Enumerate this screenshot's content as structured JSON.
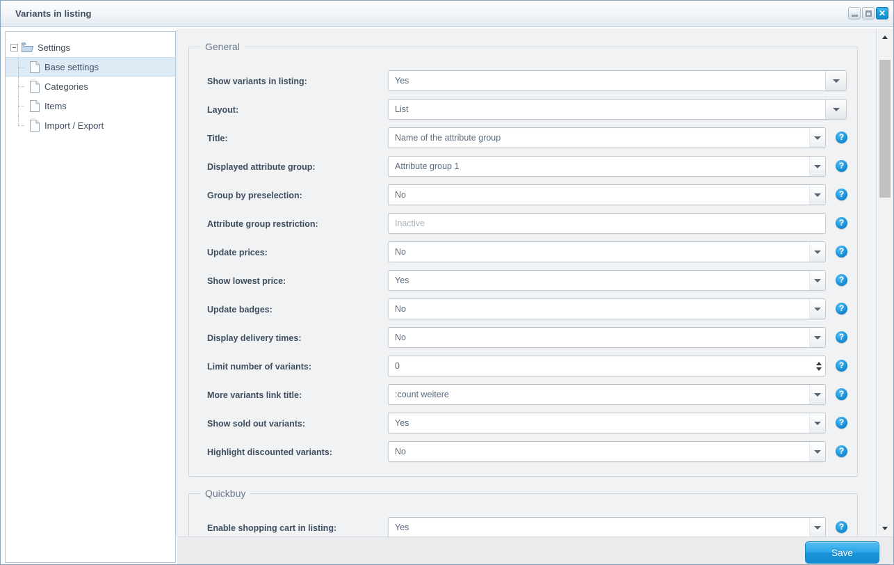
{
  "window": {
    "title": "Variants in listing",
    "controls": {
      "minimize": "minimize-button",
      "maximize": "maximize-button",
      "close": "✕"
    }
  },
  "sidebar": {
    "tree": {
      "root": {
        "label": "Settings",
        "icon": "folder-icon",
        "expanded": true
      },
      "children": [
        {
          "label": "Base settings",
          "icon": "file-icon",
          "selected": true
        },
        {
          "label": "Categories",
          "icon": "file-icon",
          "selected": false
        },
        {
          "label": "Items",
          "icon": "file-icon",
          "selected": false
        },
        {
          "label": "Import / Export",
          "icon": "file-icon",
          "selected": false
        }
      ]
    }
  },
  "main": {
    "groups": [
      {
        "legend": "General",
        "fields": [
          {
            "label": "Show variants in listing:",
            "value": "Yes",
            "control": "select",
            "help": false,
            "wide": true,
            "muted": false
          },
          {
            "label": "Layout:",
            "value": "List",
            "control": "select",
            "help": false,
            "wide": true,
            "muted": false
          },
          {
            "label": "Title:",
            "value": "Name of the attribute group",
            "control": "select",
            "help": true,
            "wide": false,
            "muted": false
          },
          {
            "label": "Displayed attribute group:",
            "value": "Attribute group 1",
            "control": "select",
            "help": true,
            "wide": false,
            "muted": false
          },
          {
            "label": "Group by preselection:",
            "value": "No",
            "control": "select",
            "help": true,
            "wide": false,
            "muted": false
          },
          {
            "label": "Attribute group restriction:",
            "value": "Inactive",
            "control": "text",
            "help": true,
            "wide": false,
            "muted": true
          },
          {
            "label": "Update prices:",
            "value": "No",
            "control": "select",
            "help": true,
            "wide": false,
            "muted": false
          },
          {
            "label": "Show lowest price:",
            "value": "Yes",
            "control": "select",
            "help": true,
            "wide": false,
            "muted": false
          },
          {
            "label": "Update badges:",
            "value": "No",
            "control": "select",
            "help": true,
            "wide": false,
            "muted": false
          },
          {
            "label": "Display delivery times:",
            "value": "No",
            "control": "select",
            "help": true,
            "wide": false,
            "muted": false
          },
          {
            "label": "Limit number of variants:",
            "value": "0",
            "control": "spinner",
            "help": true,
            "wide": false,
            "muted": false
          },
          {
            "label": "More variants link title:",
            "value": ":count weitere",
            "control": "select",
            "help": true,
            "wide": false,
            "muted": false
          },
          {
            "label": "Show sold out variants:",
            "value": "Yes",
            "control": "select",
            "help": true,
            "wide": false,
            "muted": false
          },
          {
            "label": "Highlight discounted variants:",
            "value": "No",
            "control": "select",
            "help": true,
            "wide": false,
            "muted": false
          }
        ]
      },
      {
        "legend": "Quickbuy",
        "fields": [
          {
            "label": "Enable shopping cart in listing:",
            "value": "Yes",
            "control": "select",
            "help": true,
            "wide": false,
            "muted": false
          }
        ]
      }
    ],
    "help_glyph": "?"
  },
  "footer": {
    "save_label": "Save"
  },
  "scrollbar": {
    "up_glyph": "▲",
    "down_glyph": "▼"
  },
  "colors": {
    "accent": "#1b95da",
    "label_text": "#3f4e5f",
    "value_text": "#5a6b7d",
    "muted_text": "#a8b3be",
    "legend_text": "#6b7b8c",
    "content_bg": "#f0f2f4",
    "selection_bg": "#ddebf6"
  }
}
